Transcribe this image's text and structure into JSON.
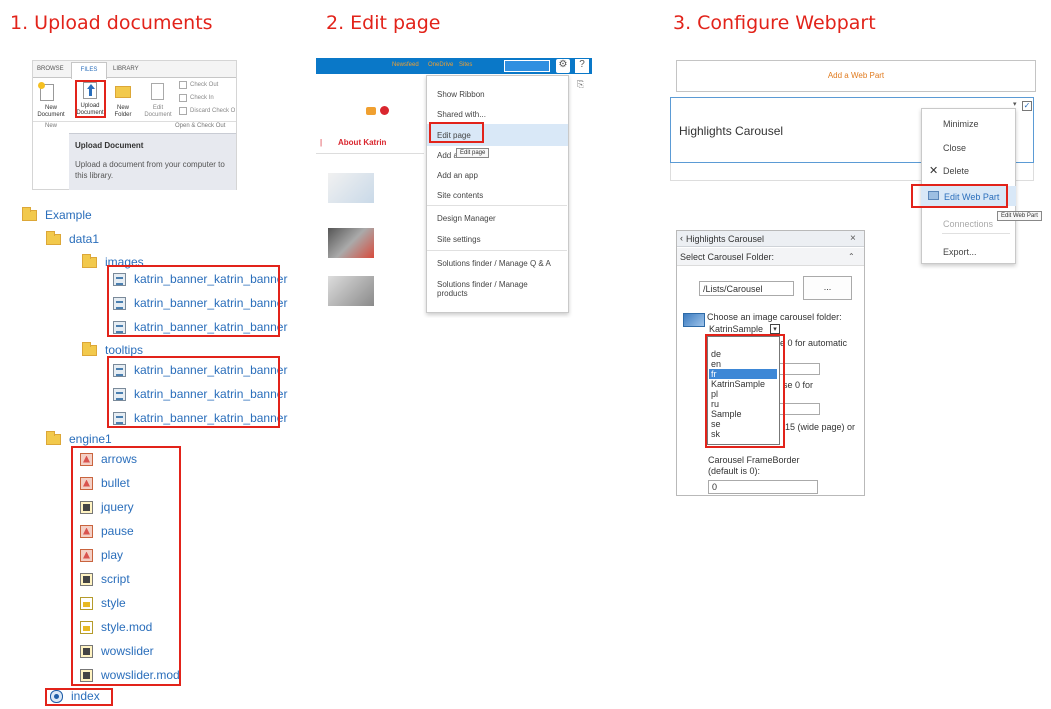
{
  "headings": {
    "step1": "1. Upload documents",
    "step2": "2. Edit page",
    "step3": "3. Configure Webpart"
  },
  "ribbon": {
    "tabs": [
      "BROWSE",
      "FILES",
      "LIBRARY"
    ],
    "new_document": "New Document",
    "upload_document": "Upload Document",
    "new_folder": "New Folder",
    "edit_document": "Edit Document",
    "check_out": "Check Out",
    "check_in": "Check In",
    "discard_check_out": "Discard Check O",
    "group_new": "New",
    "group_open_check": "Open & Check Out",
    "tooltip_title": "Upload Document",
    "tooltip_body": "Upload a document from your computer to this library."
  },
  "tree": {
    "root": "Example",
    "data1": "data1",
    "images": "images",
    "images_files": [
      "katrin_banner_katrin_banner",
      "katrin_banner_katrin_banner",
      "katrin_banner_katrin_banner"
    ],
    "tooltips": "tooltips",
    "tooltips_files": [
      "katrin_banner_katrin_banner",
      "katrin_banner_katrin_banner",
      "katrin_banner_katrin_banner"
    ],
    "engine1": "engine1",
    "engine_files": [
      "arrows",
      "bullet",
      "jquery",
      "pause",
      "play",
      "script",
      "style",
      "style.mod",
      "wowslider",
      "wowslider.mod"
    ],
    "index": "index"
  },
  "edit_page": {
    "topnav": [
      "Newsfeed",
      "OneDrive",
      "Sites"
    ],
    "about": "About Katrin",
    "menu": [
      "Show Ribbon",
      "Shared with...",
      "Edit page",
      "Add a page",
      "Add an app",
      "Site contents",
      "Design Manager",
      "Site settings",
      "Solutions finder / Manage Q & A",
      "Solutions finder / Manage products"
    ],
    "tooltip": "Edit page",
    "add_a_prefix": "Add a"
  },
  "webpart": {
    "add_web_part": "Add a Web Part",
    "title": "Highlights Carousel",
    "context_menu": [
      "Minimize",
      "Close",
      "Delete",
      "Edit Web Part",
      "Connections",
      "Export..."
    ],
    "edit_tooltip": "Edit Web Part"
  },
  "tool_pane": {
    "title": "Highlights Carousel",
    "close": "×",
    "section": "Select Carousel Folder:",
    "path_value": "/Lists/Carousel",
    "browse": "...",
    "choose_label": "Choose an image carousel folder:",
    "selected": "KatrinSample",
    "options": [
      "de",
      "en",
      "fr",
      "KatrinSample",
      "pl",
      "ru",
      "Sample",
      "se",
      "sk"
    ],
    "hint1": "e 0 for automatic",
    "hint2": "se 0 for",
    "hint3": "15 (wide page) or",
    "frameborder_label": "Carousel FrameBorder (default is 0):",
    "frameborder_value": "0"
  }
}
